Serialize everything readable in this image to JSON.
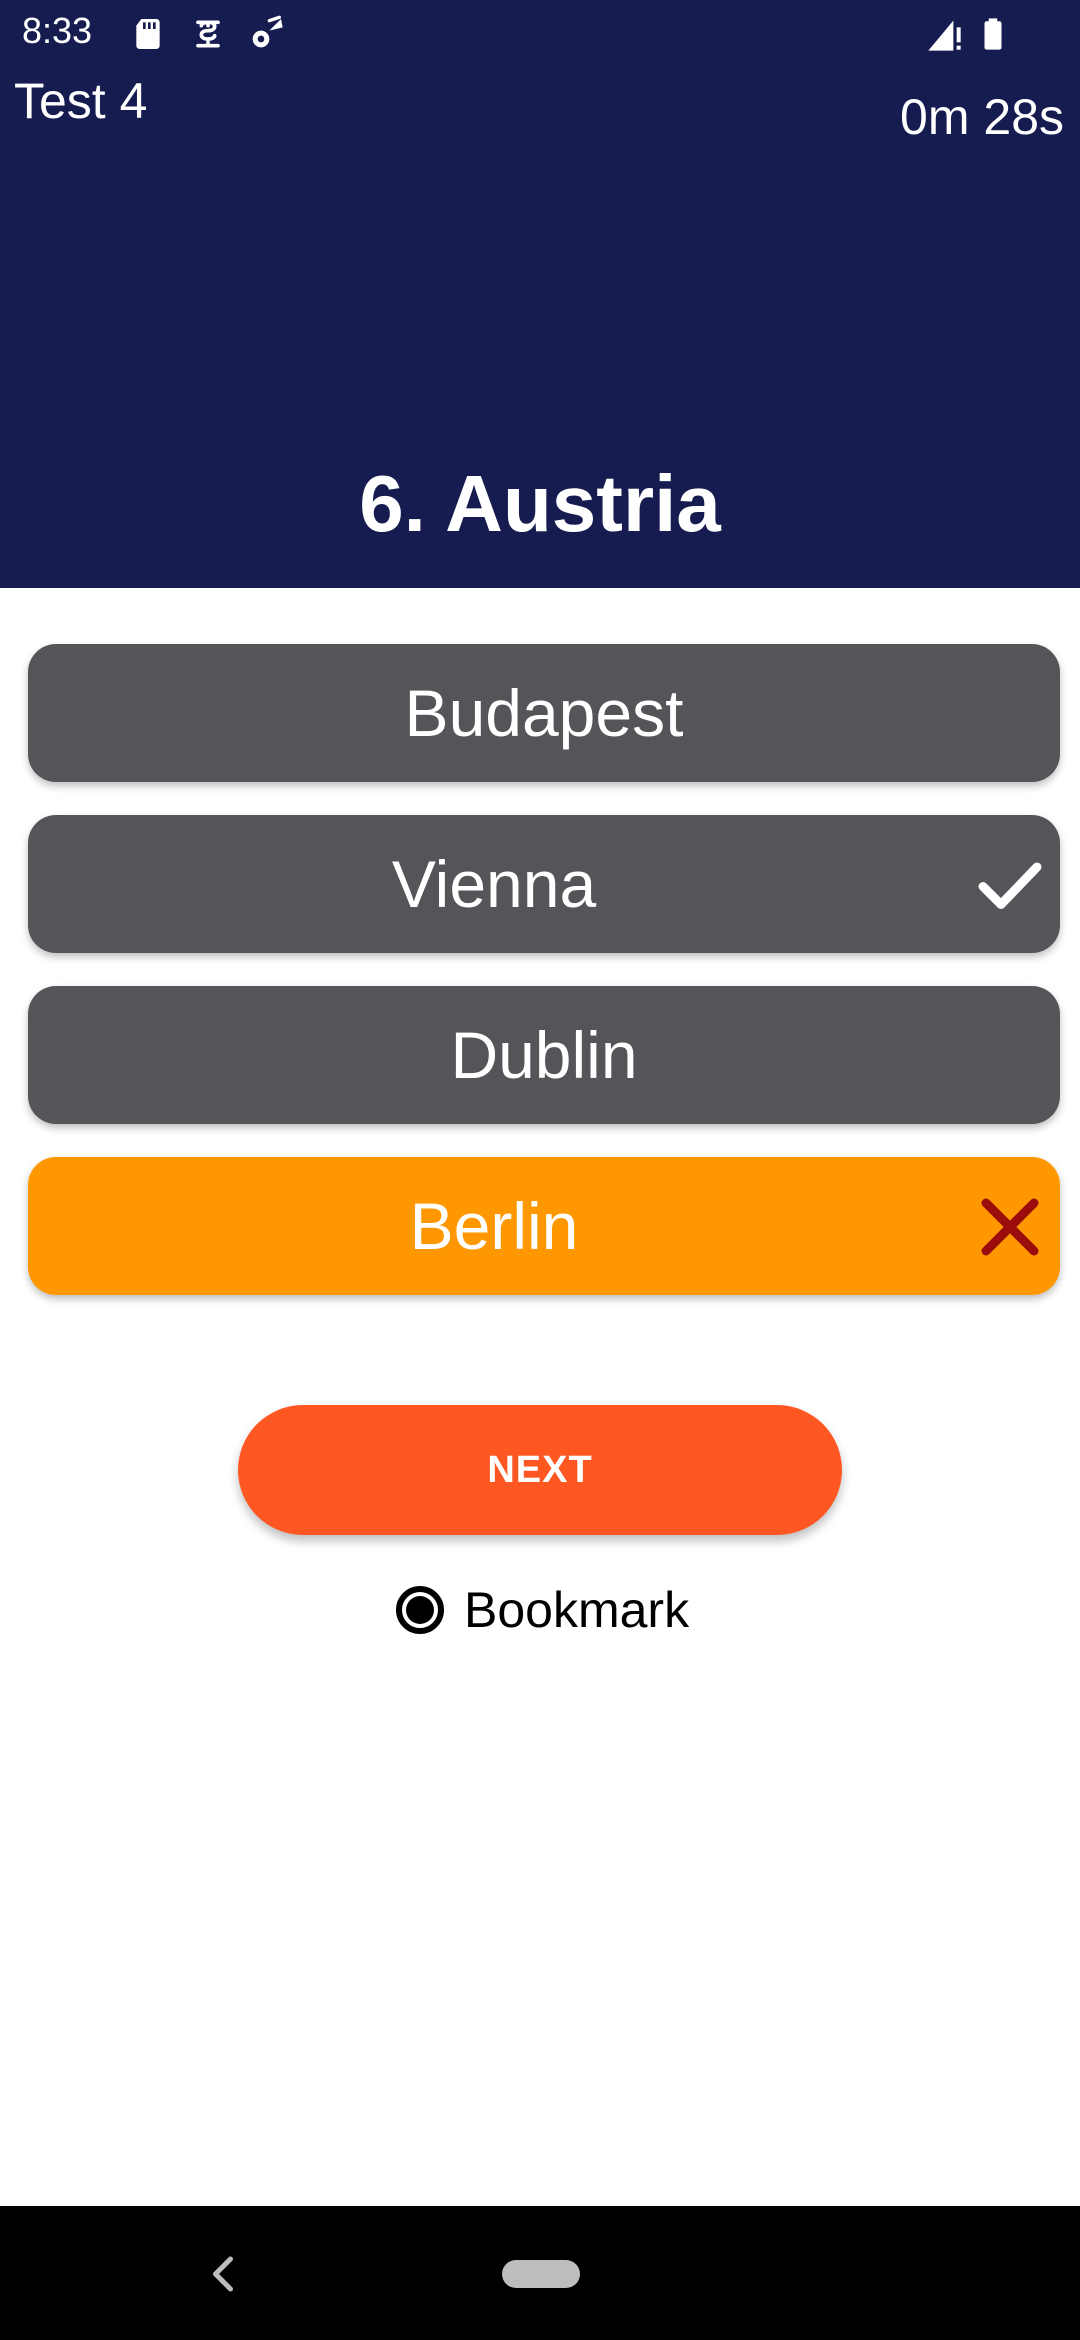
{
  "status_bar": {
    "time": "8:33",
    "left_icons": [
      "sd-card-icon",
      "sim-icon",
      "location-settings-icon"
    ],
    "right_icons": [
      "signal-icon",
      "battery-icon"
    ]
  },
  "header": {
    "test_title": "Test 4",
    "timer": "0m 28s",
    "question": "6. Austria",
    "background_color": "#161c4f"
  },
  "options": [
    {
      "label": "Budapest",
      "state": "neutral"
    },
    {
      "label": "Vienna",
      "state": "correct",
      "icon": "check-icon"
    },
    {
      "label": "Dublin",
      "state": "neutral"
    },
    {
      "label": "Berlin",
      "state": "wrong",
      "icon": "close-icon"
    }
  ],
  "colors": {
    "option_neutral": "#555559",
    "option_wrong": "#ff9800",
    "wrong_mark": "#9b0d0d",
    "next_button": "#ff5722"
  },
  "next_button": {
    "label": "NEXT"
  },
  "bookmark": {
    "label": "Bookmark",
    "selected": true
  },
  "nav_bar": {
    "icons": [
      "back-icon",
      "home-pill-icon"
    ]
  }
}
